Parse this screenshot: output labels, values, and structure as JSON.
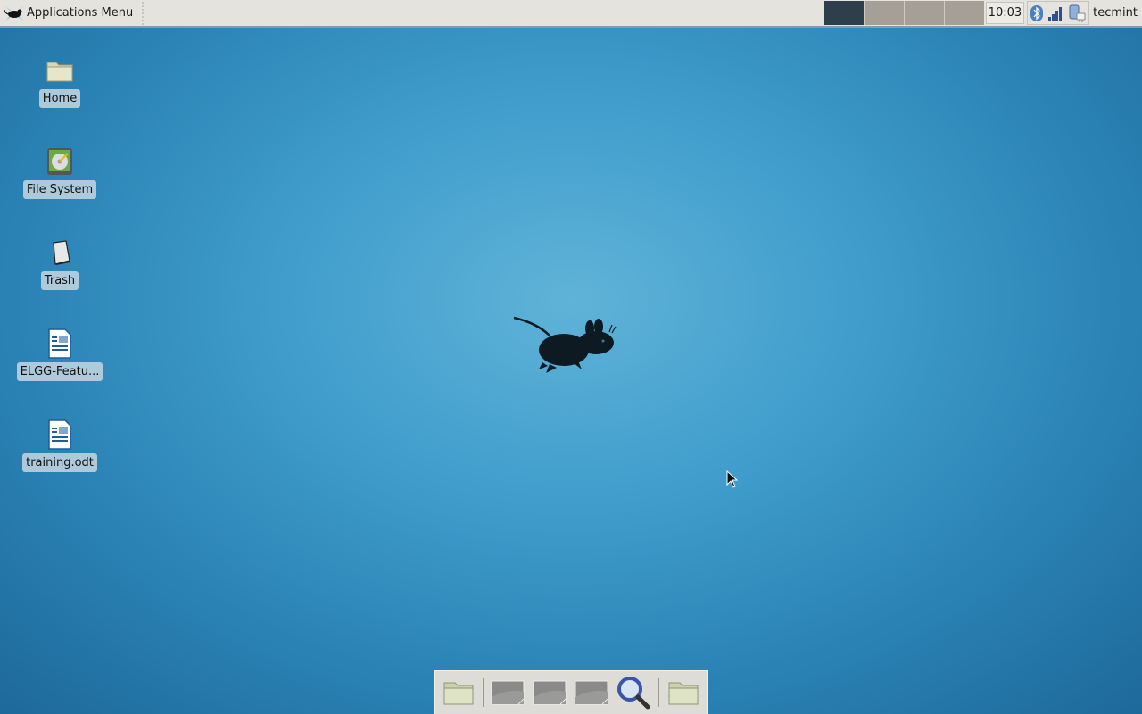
{
  "panel": {
    "app_menu_label": "Applications Menu",
    "workspaces": [
      "Workspace 1",
      "Workspace 2",
      "Workspace 3",
      "Workspace 4"
    ],
    "active_workspace": 1,
    "clock": "10:03",
    "tray_icons": [
      "bluetooth-icon",
      "network-signal-icon",
      "power-battery-icon"
    ],
    "user": "tecmint"
  },
  "desktop": {
    "icons": [
      {
        "label": "Home",
        "icon": "folder-icon"
      },
      {
        "label": "File System",
        "icon": "drive-icon"
      },
      {
        "label": "Trash",
        "icon": "trash-icon"
      },
      {
        "label": "ELGG-Featu...",
        "icon": "document-icon"
      },
      {
        "label": "training.odt",
        "icon": "document-icon"
      }
    ]
  },
  "dock": {
    "items": [
      {
        "name": "file-manager",
        "icon": "folder-icon"
      },
      {
        "name": "window-1",
        "icon": "window-icon"
      },
      {
        "name": "window-2",
        "icon": "window-icon"
      },
      {
        "name": "window-3",
        "icon": "window-icon"
      },
      {
        "name": "app-finder",
        "icon": "search-icon"
      },
      {
        "name": "folder",
        "icon": "folder-icon"
      }
    ]
  },
  "colors": {
    "panel_bg": "#e5e3dd",
    "active_workspace": "#2f3e4b",
    "inactive_workspace": "#a59f97",
    "desktop_center": "#5fb3d8",
    "desktop_edge": "#1c6596"
  }
}
